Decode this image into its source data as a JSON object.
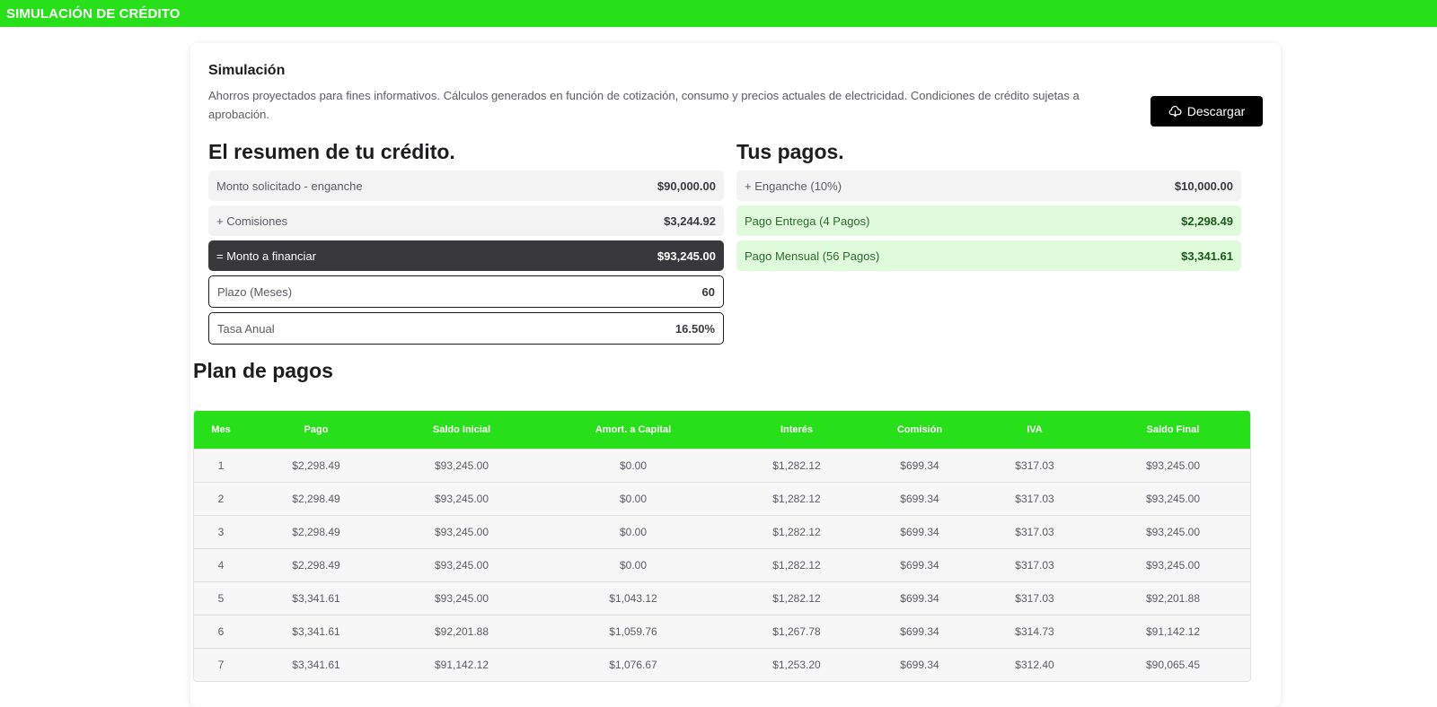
{
  "header": {
    "title": "SIMULACIÓN DE CRÉDITO"
  },
  "simulation": {
    "title": "Simulación",
    "description": "Ahorros proyectados para fines informativos. Cálculos generados en función de cotización, consumo y precios actuales de electricidad. Condiciones de crédito sujetas a aprobación.",
    "download_label": "Descargar"
  },
  "summary": {
    "title": "El resumen de tu crédito.",
    "rows": [
      {
        "label": "Monto solicitado - enganche",
        "value": "$90,000.00"
      },
      {
        "label": "+ Comisiones",
        "value": "$3,244.92"
      },
      {
        "label": "= Monto a financiar",
        "value": "$93,245.00"
      },
      {
        "label": "Plazo (Meses)",
        "value": "60"
      },
      {
        "label": "Tasa Anual",
        "value": "16.50%"
      }
    ]
  },
  "payments": {
    "title": "Tus pagos.",
    "rows": [
      {
        "label": "+ Enganche (10%)",
        "value": "$10,000.00"
      },
      {
        "label": "Pago Entrega (4 Pagos)",
        "value": "$2,298.49"
      },
      {
        "label": "Pago Mensual (56 Pagos)",
        "value": "$3,341.61"
      }
    ]
  },
  "plan": {
    "title": "Plan de pagos",
    "columns": [
      "Mes",
      "Pago",
      "Saldo Inicial",
      "Amort. a Capital",
      "Interés",
      "Comisión",
      "IVA",
      "Saldo Final"
    ],
    "rows": [
      [
        "1",
        "$2,298.49",
        "$93,245.00",
        "$0.00",
        "$1,282.12",
        "$699.34",
        "$317.03",
        "$93,245.00"
      ],
      [
        "2",
        "$2,298.49",
        "$93,245.00",
        "$0.00",
        "$1,282.12",
        "$699.34",
        "$317.03",
        "$93,245.00"
      ],
      [
        "3",
        "$2,298.49",
        "$93,245.00",
        "$0.00",
        "$1,282.12",
        "$699.34",
        "$317.03",
        "$93,245.00"
      ],
      [
        "4",
        "$2,298.49",
        "$93,245.00",
        "$0.00",
        "$1,282.12",
        "$699.34",
        "$317.03",
        "$93,245.00"
      ],
      [
        "5",
        "$3,341.61",
        "$93,245.00",
        "$1,043.12",
        "$1,282.12",
        "$699.34",
        "$317.03",
        "$92,201.88"
      ],
      [
        "6",
        "$3,341.61",
        "$92,201.88",
        "$1,059.76",
        "$1,267.78",
        "$699.34",
        "$314.73",
        "$91,142.12"
      ],
      [
        "7",
        "$3,341.61",
        "$91,142.12",
        "$1,076.67",
        "$1,253.20",
        "$699.34",
        "$312.40",
        "$90,065.45"
      ]
    ]
  }
}
